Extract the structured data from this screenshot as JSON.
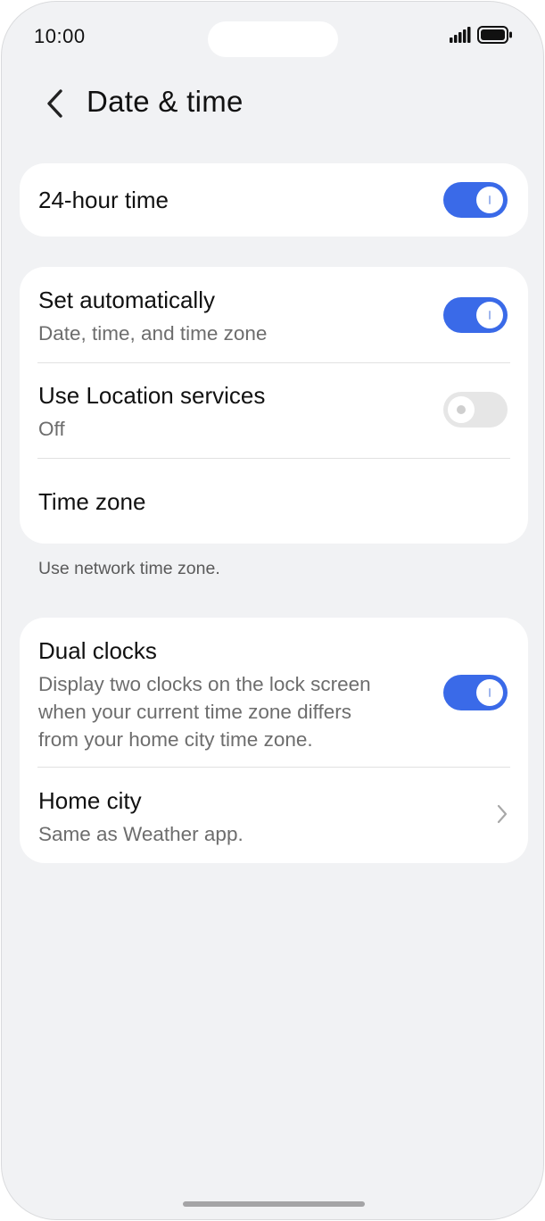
{
  "status_bar": {
    "time": "10:00",
    "icons": [
      "signal-icon",
      "battery-icon"
    ]
  },
  "header": {
    "back_icon": "chevron-left-icon",
    "title": "Date & time"
  },
  "settings": {
    "hour24": {
      "title": "24-hour time",
      "enabled": true
    },
    "auto": {
      "title": "Set automatically",
      "subtitle": "Date, time, and time zone",
      "enabled": true
    },
    "location": {
      "title": "Use Location services",
      "subtitle": "Off",
      "enabled": false
    },
    "timezone": {
      "title": "Time zone"
    },
    "caption": "Use network time zone.",
    "dual_clocks": {
      "title": "Dual clocks",
      "subtitle_lines": [
        "Display two clocks on the lock screen",
        "when your current time zone differs",
        "from your home city time zone."
      ],
      "enabled": true
    },
    "home_city": {
      "title": "Home city",
      "subtitle": "Same as Weather app."
    }
  },
  "colors": {
    "accent": "#3a6ae8",
    "background": "#f1f2f4",
    "card": "#ffffff",
    "toggle_off": "#e6e6e6"
  }
}
